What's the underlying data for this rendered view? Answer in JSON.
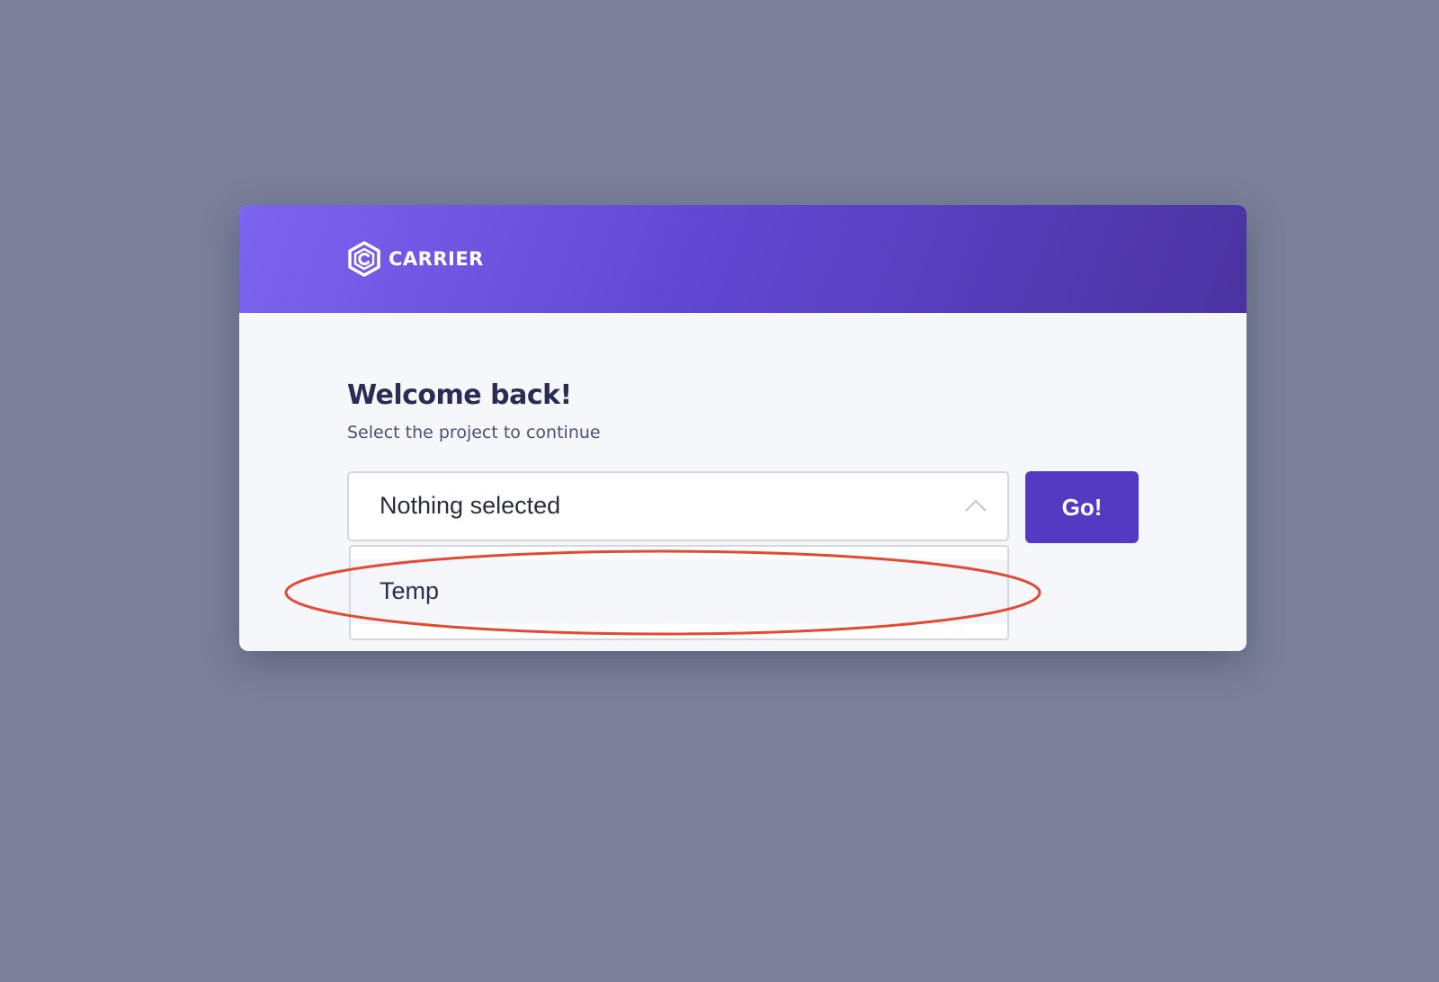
{
  "brand": {
    "name": "CARRIER",
    "icon": "carrier-hexagon-logo-icon"
  },
  "welcome": {
    "title": "Welcome back!",
    "subtitle": "Select the project to continue"
  },
  "project_select": {
    "value": "Nothing selected",
    "expanded": true,
    "options": [
      "Temp"
    ]
  },
  "go_button": {
    "label": "Go!"
  },
  "colors": {
    "background": "#7a8099",
    "header_gradient_start": "#7d64f0",
    "header_gradient_end": "#4a33a0",
    "primary_button": "#523ac2",
    "title_text": "#2a2d52",
    "annotation": "#e34a33"
  }
}
